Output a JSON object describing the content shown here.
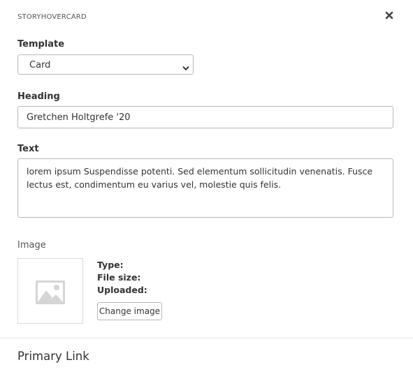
{
  "header": {
    "title": "STORYHOVERCARD",
    "close_icon": "close-icon"
  },
  "template": {
    "label": "Template",
    "selected": "Card"
  },
  "heading": {
    "label": "Heading",
    "value": "Gretchen Holtgrefe '20"
  },
  "text": {
    "label": "Text",
    "value": "lorem ipsum Suspendisse potenti. Sed elementum sollicitudin venenatis. Fusce lectus est, condimentum eu varius vel, molestie quis felis."
  },
  "image": {
    "label": "Image",
    "placeholder_icon": "image-placeholder-icon",
    "type_label": "Type:",
    "file_size_label": "File size:",
    "uploaded_label": "Uploaded:",
    "change_button": "Change image"
  },
  "primary_link": {
    "title": "Primary Link"
  }
}
